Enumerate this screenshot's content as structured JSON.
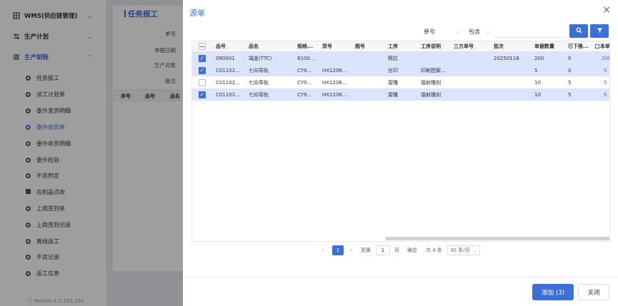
{
  "sidebar": {
    "top_items": [
      {
        "label": "WMS(供应链管理)",
        "chevron": "⌄"
      },
      {
        "label": "生产计划",
        "chevron": "⌄"
      },
      {
        "label": "生产制程",
        "chevron": "⌃"
      }
    ],
    "sub_items": [
      {
        "label": "任务报工"
      },
      {
        "label": "派工计划单"
      },
      {
        "label": "委外发货明细"
      },
      {
        "label": "委外收货单"
      },
      {
        "label": "委外收货明细"
      },
      {
        "label": "委外检验"
      },
      {
        "label": "不良判定"
      },
      {
        "label": "在制品点收"
      },
      {
        "label": "上岗签到单"
      },
      {
        "label": "上岗签到记录"
      },
      {
        "label": "离线返工"
      },
      {
        "label": "不良记录"
      },
      {
        "label": "返工信息"
      }
    ],
    "version": "ⓘ Version:1.2.501.161"
  },
  "background_page": {
    "title": "任务报工",
    "form_labels": [
      "单号",
      "单据日期",
      "生产对象",
      "备注"
    ],
    "table_headers": [
      "序号",
      "品号",
      "品名"
    ]
  },
  "modal": {
    "title": "源单",
    "close": "×",
    "filter": {
      "field": "单号",
      "operator": "包含",
      "value": ""
    },
    "columns": [
      "品号",
      "品名",
      "规格...",
      "货号",
      "图号",
      "工序",
      "工序说明",
      "三方单号",
      "批次",
      "单据数量",
      "已下推...",
      "本单"
    ],
    "rows": [
      {
        "checked": true,
        "cells": [
          "090001",
          "端盖(TTC)",
          "8100...",
          "",
          "",
          "精拉",
          "",
          "",
          "20250118",
          "200",
          "0",
          "200"
        ]
      },
      {
        "checked": true,
        "cells": [
          "C01102...",
          "七向导轨",
          "CY9...",
          "HX1206...",
          "",
          "丝印",
          "印刷图案...",
          "",
          "",
          "5",
          "0",
          "5"
        ]
      },
      {
        "checked": false,
        "cells": [
          "C01102...",
          "七向导轨",
          "CY9...",
          "HX1206...",
          "",
          "雷雕",
          "镭射雕刻",
          "",
          "",
          "10",
          "5",
          "5"
        ]
      },
      {
        "checked": true,
        "cells": [
          "C01102...",
          "七向导轨",
          "CY9...",
          "HX1206...",
          "",
          "雷雕",
          "镭射雕刻",
          "",
          "",
          "10",
          "5",
          "5"
        ]
      }
    ],
    "pager": {
      "current": "1",
      "goto_label": "到第",
      "goto_value": "1",
      "page_unit": "页",
      "confirm": "确定",
      "total": "共 4 条",
      "page_size": "30 条/页"
    },
    "add_button": "添加 (3)",
    "close_button": "关闭"
  }
}
